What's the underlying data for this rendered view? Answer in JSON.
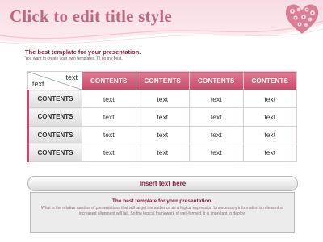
{
  "title": "Click to edit title style",
  "subtitle": "The best template for your presentation.",
  "subnote": "You want to create your own templates. I'll do my best.",
  "table": {
    "corner_top": "text",
    "corner_bottom": "text",
    "headers": [
      "CONTENTS",
      "CONTENTS",
      "CONTENTS",
      "CONTENTS"
    ],
    "rows": [
      {
        "label": "CONTENTS",
        "cells": [
          "text",
          "text",
          "text",
          "text"
        ]
      },
      {
        "label": "CONTENTS",
        "cells": [
          "text",
          "text",
          "text",
          "text"
        ]
      },
      {
        "label": "CONTENTS",
        "cells": [
          "text",
          "text",
          "text",
          "text"
        ]
      },
      {
        "label": "CONTENTS",
        "cells": [
          "text",
          "text",
          "text",
          "text"
        ]
      }
    ]
  },
  "insert_text": "Insert text here",
  "info": {
    "title": "The best template for your presentation.",
    "body": "What is the relative number of presentations that will target the audience as a logical expression Unnecessary information is released or increased alignment will fail. So the logical framework of well-formed, it is important to deploy."
  },
  "colors": {
    "accent": "#c74a6a",
    "title": "#c2667c",
    "dark_accent": "#8c1f3e"
  },
  "icons": {
    "logo": "floral-heart-icon"
  }
}
